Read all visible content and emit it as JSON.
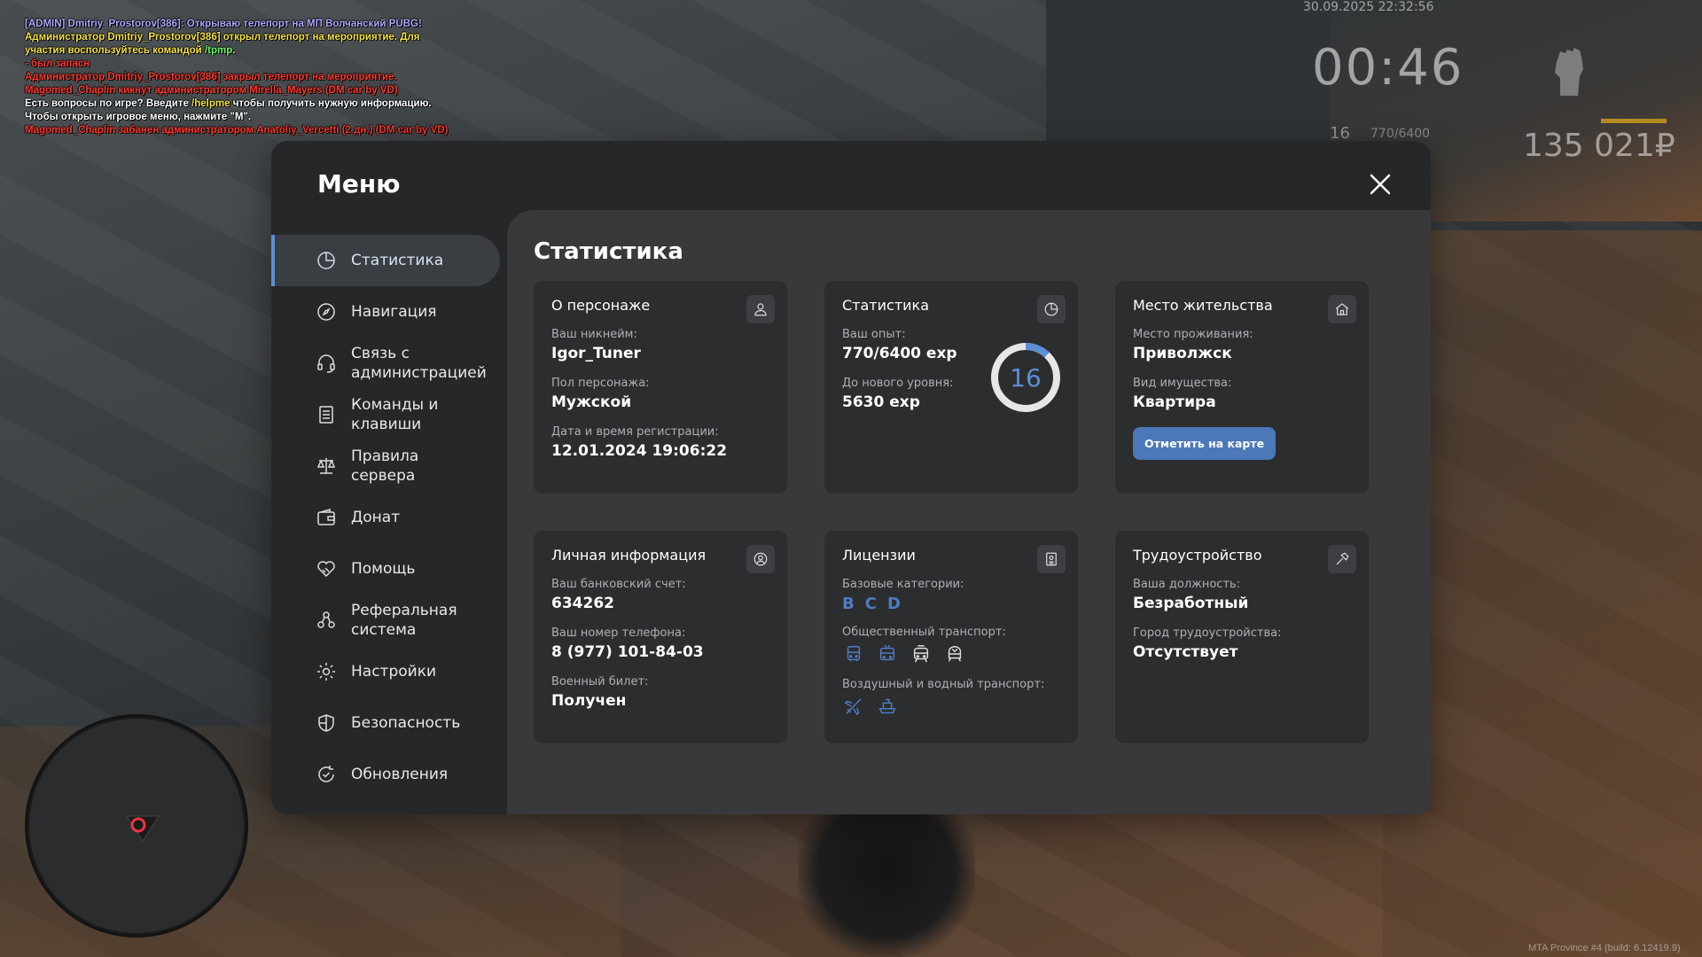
{
  "chat": [
    {
      "segments": [
        {
          "text": "[ADMIN] Dmitriy_Prostorov[386]: Открываю телепорт на МП Волчанский PUBG!",
          "color": "admin"
        }
      ]
    },
    {
      "segments": [
        {
          "text": "Администратор Dmitriy_Prostorov[386] открыл телепорт на мероприятие. Для участия воспользуйтесь командой ",
          "color": "yellow"
        },
        {
          "text": "/tpmp",
          "color": "green"
        },
        {
          "text": ".",
          "color": "yellow"
        }
      ]
    },
    {
      "segments": [
        {
          "text": "- был запасн",
          "color": "red"
        }
      ]
    },
    {
      "segments": [
        {
          "text": "Администратор Dmitriy_Prostorov[386] закрыл телепорт на мероприятие.",
          "color": "red"
        }
      ]
    },
    {
      "segments": [
        {
          "text": "Magomed_Chaplin кикнут администратором Mirella_Mayers (DM car by VD)",
          "color": "red"
        }
      ]
    },
    {
      "segments": [
        {
          "text": "Есть вопросы по игре? Введите ",
          "color": "white"
        },
        {
          "text": "/helpme",
          "color": "yellow"
        },
        {
          "text": " чтобы получить нужную информацию.",
          "color": "white"
        }
      ]
    },
    {
      "segments": [
        {
          "text": "Чтобы открыть игровое меню, нажмите \"M\".",
          "color": "white"
        }
      ]
    },
    {
      "segments": [
        {
          "text": "Magomed_Chaplin забанен администратором Anatoliy_Vercetti (2 дн.) (DM car by VD)",
          "color": "red"
        }
      ]
    }
  ],
  "hud": {
    "datetime": "30.09.2025 22:32:56",
    "time": "00:46",
    "level": "16",
    "exp": "770/6400",
    "money": "135 021₽",
    "build": "MTA Province #4 (build: 6.12419.9)"
  },
  "menu": {
    "title": "Меню",
    "close_icon": "close-icon",
    "items": [
      {
        "label": "Статистика",
        "icon": "pie-chart-icon",
        "active": true
      },
      {
        "label": "Навигация",
        "icon": "compass-icon"
      },
      {
        "label": "Связь с администрацией",
        "icon": "headset-icon"
      },
      {
        "label": "Команды и клавиши",
        "icon": "list-icon"
      },
      {
        "label": "Правила сервера",
        "icon": "scales-icon"
      },
      {
        "label": "Донат",
        "icon": "wallet-icon"
      },
      {
        "label": "Помощь",
        "icon": "handshake-heart-icon"
      },
      {
        "label": "Реферальная система",
        "icon": "referral-icon"
      },
      {
        "label": "Настройки",
        "icon": "gear-icon"
      },
      {
        "label": "Безопасность",
        "icon": "shield-icon"
      },
      {
        "label": "Обновления",
        "icon": "refresh-check-icon"
      }
    ]
  },
  "stats": {
    "title": "Статистика",
    "character": {
      "title": "О персонаже",
      "nick_label": "Ваш никнейм:",
      "nick": "Igor_Tuner",
      "gender_label": "Пол персонажа:",
      "gender": "Мужской",
      "reg_label": "Дата и время регистрации:",
      "reg": "12.01.2024 19:06:22"
    },
    "statistics": {
      "title": "Статистика",
      "exp_label": "Ваш опыт:",
      "exp": "770/6400 exp",
      "next_label": "До нового уровня:",
      "next": "5630 exp",
      "level": "16",
      "progress": 0.12
    },
    "residence": {
      "title": "Место жительства",
      "place_label": "Место проживания:",
      "place": "Приволжск",
      "property_label": "Вид имущества:",
      "property": "Квартира",
      "map_button": "Отметить на карте"
    },
    "personal": {
      "title": "Личная информация",
      "bank_label": "Ваш банковский счет:",
      "bank": "634262",
      "phone_label": "Ваш номер телефона:",
      "phone": "8 (977) 101-84-03",
      "military_label": "Военный билет:",
      "military": "Получен"
    },
    "licenses": {
      "title": "Лицензии",
      "base_label": "Базовые категории:",
      "categories": [
        "B",
        "C",
        "D"
      ],
      "public_label": "Общественный транспорт:",
      "public_icons": [
        "bus-icon",
        "trolleybus-icon",
        "tram-icon",
        "metro-icon"
      ],
      "airwater_label": "Воздушный и водный транспорт:",
      "airwater_icons": [
        "plane-icon",
        "boat-icon"
      ]
    },
    "employment": {
      "title": "Трудоустройство",
      "position_label": "Ваша должность:",
      "position": "Безработный",
      "city_label": "Город трудоустройства:",
      "city": "Отсутствует"
    }
  },
  "colors": {
    "accent": "#5b8fd6",
    "button": "#4b78b8",
    "modal_bg": "#262728",
    "content_bg": "#39393b",
    "card_bg": "#2c2d2f"
  }
}
